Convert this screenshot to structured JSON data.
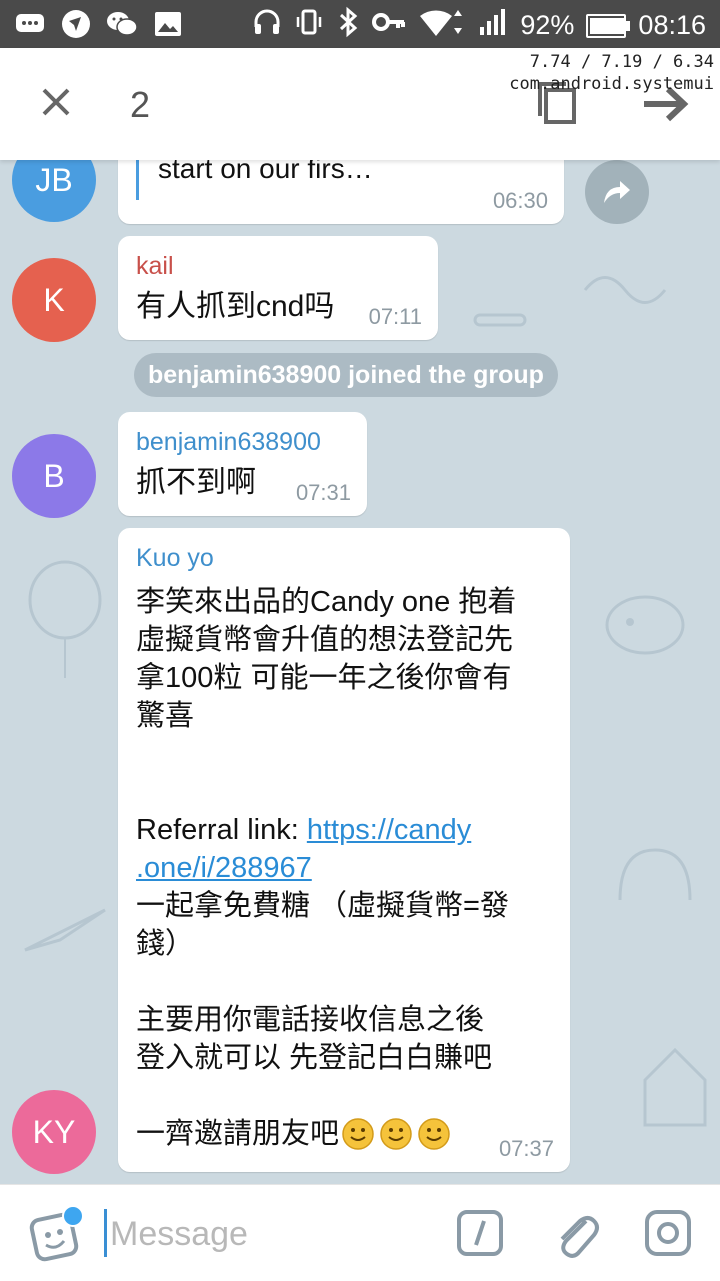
{
  "status_bar": {
    "left_icons": [
      "message-icon",
      "logo-icon",
      "wechat-icon",
      "image-icon"
    ],
    "right_icons": [
      "headphones-icon",
      "vibrate-icon",
      "bluetooth-icon",
      "key-icon",
      "wifi-icon",
      "signal-icon"
    ],
    "battery": "92%",
    "battery_level": 0.92,
    "time": "08:16"
  },
  "top_bar": {
    "selected_count": "2",
    "debug_line1": "7.74 / 7.19 / 6.34",
    "debug_line2": "com.android.systemui",
    "icons": [
      "close-icon",
      "copy-icon",
      "forward-icon"
    ]
  },
  "chat": {
    "messages": [
      {
        "avatar_initials": "JB",
        "avatar_color": "#4a9de0",
        "text": "start on our firs…",
        "time": "06:30",
        "quote_color": "#4a9de0"
      },
      {
        "avatar_initials": "K",
        "avatar_color": "#e5614f",
        "sender": "kail",
        "sender_color": "#c8504a",
        "text": "有人抓到cnd吗",
        "time": "07:11"
      },
      {
        "avatar_initials": "B",
        "avatar_color": "#8c79e8",
        "sender": "benjamin638900",
        "sender_color": "#3f8fcc",
        "text": "抓不到啊",
        "time": "07:31"
      },
      {
        "avatar_initials": "KY",
        "avatar_color": "#ec6a9a",
        "sender": "Kuo yo",
        "sender_color": "#3f8fcc",
        "text_part1": "李笑來出品的Candy one 抱着\n虛擬貨幣會升值的想法登記先\n拿100粒 可能一年之後你會有\n驚喜",
        "referral_label": "Referral link: ",
        "link_line1": "https://candy",
        "link_line2": ".one/i/288967",
        "text_part2": "一起拿免費糖 （虛擬貨幣=發\n錢）",
        "text_part3": " 主要用你電話接收信息之後\n登入就可以 先登記白白賺吧",
        "text_part4": "一齊邀請朋友吧",
        "time": "07:37"
      }
    ],
    "service_message": "benjamin638900 joined the group"
  },
  "input_bar": {
    "placeholder": "Message",
    "icons": [
      "sticker-icon",
      "bot-command-icon",
      "attach-icon",
      "camera-icon"
    ]
  }
}
